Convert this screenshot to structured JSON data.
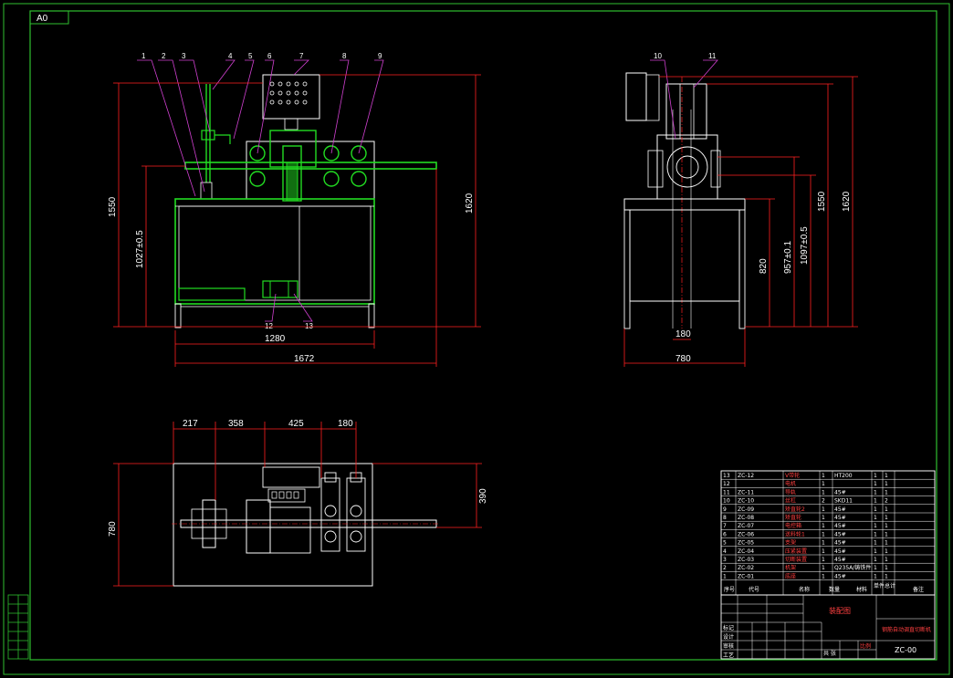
{
  "sheet": {
    "size_label": "A0"
  },
  "colors": {
    "frame": "#2fbf2f",
    "line": "#ffffff",
    "dim": "#ff2020",
    "leader": "#d040d0",
    "green_part": "#22dd22",
    "background": "#000000"
  },
  "front_view": {
    "balloons": [
      "1",
      "2",
      "3",
      "4",
      "5",
      "6",
      "7",
      "8",
      "9"
    ],
    "bottom_balloons": [
      "12",
      "13"
    ],
    "dims": {
      "height_total": "1550",
      "height_table": "1027±0.5",
      "height_right": "1620",
      "width_inner": "1280",
      "width_total": "1672"
    }
  },
  "side_view": {
    "balloons": [
      "10",
      "11"
    ],
    "dims": {
      "h820": "820",
      "h957": "957±0.1",
      "h1097": "1097±0.5",
      "h1550": "1550",
      "h1620": "1620",
      "w180": "180",
      "w780": "780"
    }
  },
  "top_view": {
    "dims": {
      "d217": "217",
      "d358": "358",
      "d425": "425",
      "d180": "180",
      "d390": "390",
      "d780": "780"
    }
  },
  "parts_list": {
    "rows": [
      {
        "no": "13",
        "code": "ZC-12",
        "name": "V带轮",
        "qty": "1",
        "material": "HT200",
        "a": "1",
        "b": "1"
      },
      {
        "no": "12",
        "code": "",
        "name": "电机",
        "qty": "1",
        "material": "",
        "a": "1",
        "b": "1"
      },
      {
        "no": "11",
        "code": "ZC-11",
        "name": "导轨",
        "qty": "1",
        "material": "45#",
        "a": "1",
        "b": "1"
      },
      {
        "no": "10",
        "code": "ZC-10",
        "name": "丝杠",
        "qty": "2",
        "material": "SKD11",
        "a": "1",
        "b": "2"
      },
      {
        "no": "9",
        "code": "ZC-09",
        "name": "矫直轮2",
        "qty": "1",
        "material": "45#",
        "a": "1",
        "b": "1"
      },
      {
        "no": "8",
        "code": "ZC-08",
        "name": "矫直轮",
        "qty": "1",
        "material": "45#",
        "a": "1",
        "b": "1"
      },
      {
        "no": "7",
        "code": "ZC-07",
        "name": "电控箱",
        "qty": "1",
        "material": "45#",
        "a": "1",
        "b": "1"
      },
      {
        "no": "6",
        "code": "ZC-06",
        "name": "送料轮1",
        "qty": "1",
        "material": "45#",
        "a": "1",
        "b": "1"
      },
      {
        "no": "5",
        "code": "ZC-05",
        "name": "支架",
        "qty": "1",
        "material": "45#",
        "a": "1",
        "b": "1"
      },
      {
        "no": "4",
        "code": "ZC-04",
        "name": "压紧装置",
        "qty": "1",
        "material": "45#",
        "a": "1",
        "b": "1"
      },
      {
        "no": "3",
        "code": "ZC-03",
        "name": "切断装置",
        "qty": "1",
        "material": "45#",
        "a": "1",
        "b": "1"
      },
      {
        "no": "2",
        "code": "ZC-02",
        "name": "机架",
        "qty": "1",
        "material": "Q235A/铸铁件",
        "a": "1",
        "b": "1"
      },
      {
        "no": "1",
        "code": "ZC-01",
        "name": "底座",
        "qty": "1",
        "material": "45#",
        "a": "1",
        "b": "1"
      }
    ],
    "header": {
      "no": "序号",
      "code": "代号",
      "name": "名称",
      "qty": "数量",
      "material": "材料",
      "a": "单件",
      "b": "总计",
      "note": "备注"
    }
  },
  "title_block": {
    "title": "装配图",
    "drawing_name": "钢筋自动调直切断机",
    "drawing_no": "ZC-00",
    "row_labels": [
      "标记",
      "设计",
      "审核",
      "工艺"
    ],
    "sheet_count": "共 张",
    "red_note": "比例"
  }
}
